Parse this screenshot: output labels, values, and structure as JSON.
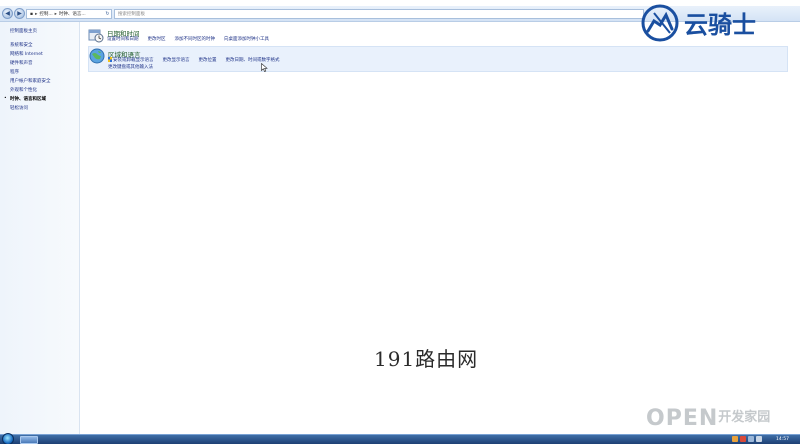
{
  "address_bar": {
    "breadcrumb": [
      "控制...",
      "时钟、语言..."
    ],
    "search_placeholder": "搜索控制面板"
  },
  "logo": {
    "text": "云骑士"
  },
  "left_nav": {
    "home": "控制面板主页",
    "items": [
      "系统和安全",
      "网络和 Internet",
      "硬件和声音",
      "程序",
      "用户帐户和家庭安全",
      "外观和个性化",
      "时钟、语言和区域",
      "轻松访问"
    ],
    "current_index": 6
  },
  "categories": [
    {
      "title": "日期和时间",
      "links": [
        "设置时间和日期",
        "更改时区",
        "添加不同时区的时钟",
        "向桌面添加时钟小工具"
      ],
      "links2": []
    },
    {
      "title": "区域和语言",
      "links": [
        "安装或卸载显示语言",
        "更改显示语言",
        "更改位置",
        "更改日期、时间或数字格式"
      ],
      "links2": [
        "更改键盘或其他输入法"
      ]
    }
  ],
  "watermarks": {
    "site": "191路由网",
    "open_latin": "OPEN",
    "open_cn": "开发家园"
  },
  "taskbar": {
    "clock": "14:57"
  },
  "colors": {
    "link": "#1e3287",
    "title_green": "#1e5a28",
    "region_highlight": "#e9f1fc",
    "taskbar": "#1d3f73",
    "logo_blue": "#1a4fa0"
  }
}
